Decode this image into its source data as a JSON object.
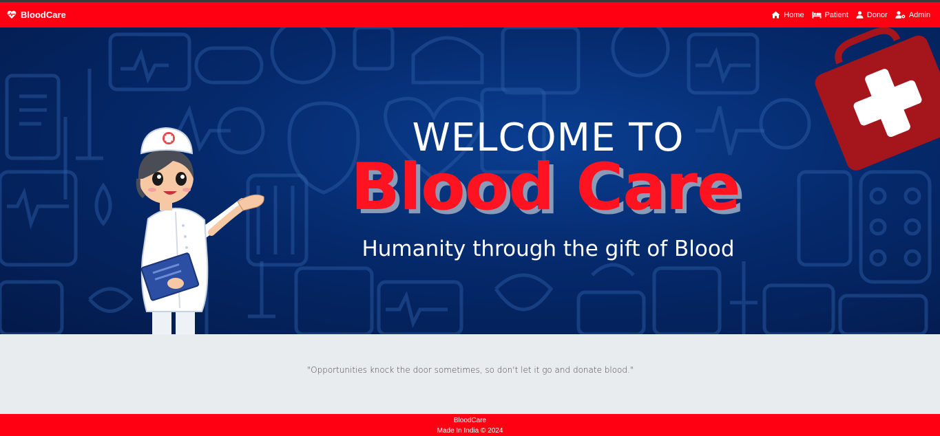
{
  "navbar": {
    "brand": "BloodCare",
    "links": [
      {
        "label": "Home",
        "icon": "home-icon"
      },
      {
        "label": "Patient",
        "icon": "bed-icon"
      },
      {
        "label": "Donor",
        "icon": "user-icon"
      },
      {
        "label": "Admin",
        "icon": "user-cog-icon"
      }
    ]
  },
  "hero": {
    "welcome": "WELCOME TO",
    "title": "Blood Care",
    "tagline": "Humanity through the gift of Blood"
  },
  "quote": "\"Opportunities knock the door sometimes, so don't let it go and donate blood.\"",
  "footer": {
    "brand": "BloodCare",
    "credit": "Made In India © 2024"
  },
  "colors": {
    "brand_red": "#ff0013",
    "hero_blue": "#05296b",
    "title_red": "#ff1320",
    "medkit_red": "#a4161c"
  }
}
